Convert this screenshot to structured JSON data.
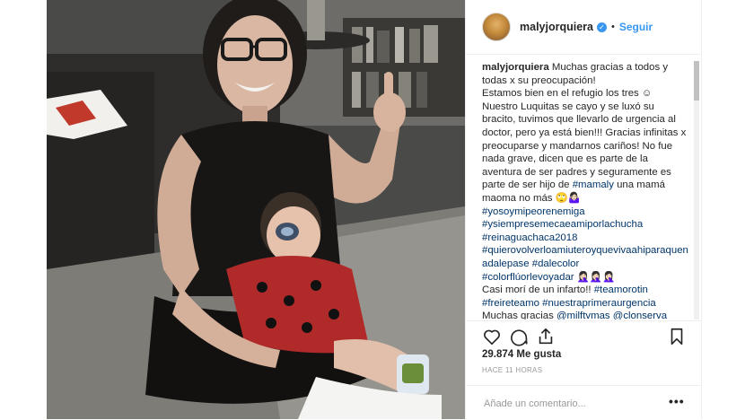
{
  "post": {
    "username": "malyjorquiera",
    "verified_icon": "verified-badge-icon",
    "separator": "•",
    "follow_label": "Seguir"
  },
  "caption": {
    "author": "malyjorquiera",
    "lines": [
      "Muchas gracias a todos y todas x su preocupación!",
      "Estamos bien en el refugio los tres ☺",
      "Nuestro Luquitas se cayo y se luxó su bracito, tuvimos que llevarlo de urgencia al doctor, pero ya está bien!!! Gracias infinitas x preocuparse y mandarnos cariños! No fue nada grave, dicen que es parte de la aventura de ser padres y seguramente es parte de ser hijo de"
    ],
    "tag_mamaly": "#mamaly",
    "after_mamaly": " una mamá maoma no más 🙄🤷🏻‍♀",
    "hashtags": [
      "#yosoymipeorenemiga",
      "#ysiempresemecaeamiporlachucha",
      "#reinaguachaca2018",
      "#quierovolverloamiuteroyquevivaahiparaquenadalepase"
    ],
    "tag_dalecolor": "#dalecolor",
    "tag_colorfluor": "#colorflúorlevoyadar",
    "emoji_run": " 🤦🏻‍♀🤦🏻‍♀🤦🏻‍♀",
    "infarto_text": "Casi morí de un infarto!! ",
    "tag_teamo": "#teamorotin",
    "tag_freire": "#freireteamo",
    "tag_urgencia": "#nuestraprimeraurgencia",
    "gracias_text": "Muchas gracias ",
    "mention_milf": "@milftvmas",
    "mention_clon": "@clonserva"
  },
  "actions": {
    "like_icon": "heart-icon",
    "comment_icon": "comment-bubble-icon",
    "share_icon": "share-icon",
    "save_icon": "bookmark-icon"
  },
  "stats": {
    "likes": "29.874 Me gusta",
    "timestamp": "HACE 11 HORAS"
  },
  "comment_box": {
    "placeholder": "Añade un comentario...",
    "more_label": "•••"
  },
  "colors": {
    "link": "#3897f0",
    "hashtag": "#003569",
    "border": "#efefef"
  }
}
